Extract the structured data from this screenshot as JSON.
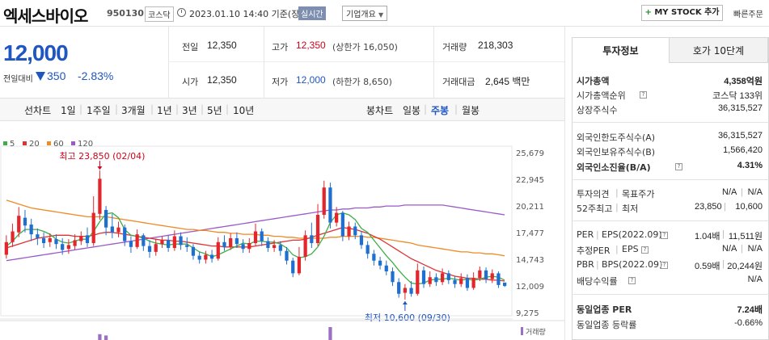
{
  "header": {
    "stock_name": "엑세스바이오",
    "stock_code": "950130",
    "market": "코스닥",
    "datetime": "2023.01.10 14:40 기준(장중)",
    "realtime": "실시간",
    "company_overview": "기업개요",
    "mystock_label": "MY STOCK 추가",
    "quick_order": "빠른주문"
  },
  "price": {
    "current": "12,000",
    "change_label": "전일대비",
    "change": "350",
    "change_pct": "-2.83%",
    "direction": "down"
  },
  "stats": {
    "prev_close_label": "전일",
    "prev_close": "12,350",
    "high_label": "고가",
    "high": "12,350",
    "upper_limit": "(상한가 16,050)",
    "volume_label": "거래량",
    "volume": "218,303",
    "open_label": "시가",
    "open": "12,350",
    "low_label": "저가",
    "low": "12,000",
    "lower_limit": "(하한가 8,650)",
    "amount_label": "거래대금",
    "amount": "2,645 백만"
  },
  "tabs": {
    "line_chart": "선차트",
    "line_periods": [
      "1일",
      "1주일",
      "3개월",
      "1년",
      "3년",
      "5년",
      "10년"
    ],
    "candle_chart": "봉차트",
    "candle_periods": [
      "일봉",
      "주봉",
      "월봉"
    ],
    "active_candle": "주봉"
  },
  "chart_data": {
    "type": "candlestick",
    "moving_average_legend": [
      {
        "name": "5",
        "color": "#3fae49"
      },
      {
        "name": "20",
        "color": "#e03232"
      },
      {
        "name": "60",
        "color": "#f08a24"
      },
      {
        "name": "120",
        "color": "#9b59c9"
      }
    ],
    "y_ticks": [
      "25,679",
      "22,945",
      "20,211",
      "17,477",
      "14,743",
      "12,009",
      "9,275"
    ],
    "y_tick_values": [
      25679,
      22945,
      20211,
      17477,
      14743,
      12009,
      9275
    ],
    "high_annotation": "최고 23,850 (02/04)",
    "low_annotation": "최저 10,600 (09/30)",
    "volume_label": "거래량",
    "candles": [
      {
        "o": 15200,
        "c": 16500,
        "h": 17200,
        "l": 14800
      },
      {
        "o": 16500,
        "c": 17600,
        "h": 18400,
        "l": 16000
      },
      {
        "o": 17500,
        "c": 19200,
        "h": 20100,
        "l": 17000
      },
      {
        "o": 19000,
        "c": 18200,
        "h": 19800,
        "l": 17500
      },
      {
        "o": 18300,
        "c": 17300,
        "h": 18900,
        "l": 16600
      },
      {
        "o": 17300,
        "c": 16900,
        "h": 17900,
        "l": 16200
      },
      {
        "o": 16900,
        "c": 16400,
        "h": 17500,
        "l": 15900
      },
      {
        "o": 16500,
        "c": 16900,
        "h": 17400,
        "l": 16000
      },
      {
        "o": 16800,
        "c": 16300,
        "h": 17300,
        "l": 15800
      },
      {
        "o": 16300,
        "c": 15700,
        "h": 16900,
        "l": 15200
      },
      {
        "o": 15800,
        "c": 16200,
        "h": 16800,
        "l": 15300
      },
      {
        "o": 16100,
        "c": 16700,
        "h": 17300,
        "l": 15700
      },
      {
        "o": 16600,
        "c": 17100,
        "h": 17600,
        "l": 16200
      },
      {
        "o": 17200,
        "c": 16400,
        "h": 18000,
        "l": 16000
      },
      {
        "o": 16400,
        "c": 19500,
        "h": 21200,
        "l": 16100
      },
      {
        "o": 19400,
        "c": 23000,
        "h": 23850,
        "l": 18800
      },
      {
        "o": 19800,
        "c": 18000,
        "h": 20200,
        "l": 17200
      },
      {
        "o": 18100,
        "c": 17500,
        "h": 19400,
        "l": 16900
      },
      {
        "o": 17500,
        "c": 18000,
        "h": 18600,
        "l": 17000
      },
      {
        "o": 18000,
        "c": 16600,
        "h": 18300,
        "l": 16100
      },
      {
        "o": 16600,
        "c": 16000,
        "h": 17100,
        "l": 15400
      },
      {
        "o": 16000,
        "c": 17300,
        "h": 17800,
        "l": 15800
      },
      {
        "o": 17200,
        "c": 16100,
        "h": 17400,
        "l": 15600
      },
      {
        "o": 16100,
        "c": 15500,
        "h": 16700,
        "l": 14900
      },
      {
        "o": 15500,
        "c": 16300,
        "h": 16800,
        "l": 15100
      },
      {
        "o": 16300,
        "c": 16700,
        "h": 17100,
        "l": 15900
      },
      {
        "o": 16700,
        "c": 15900,
        "h": 17200,
        "l": 15500
      },
      {
        "o": 15900,
        "c": 17100,
        "h": 17700,
        "l": 15600
      },
      {
        "o": 17100,
        "c": 16200,
        "h": 17500,
        "l": 15700
      },
      {
        "o": 16200,
        "c": 16000,
        "h": 17000,
        "l": 15500
      },
      {
        "o": 16000,
        "c": 15100,
        "h": 16300,
        "l": 14700
      },
      {
        "o": 15100,
        "c": 14700,
        "h": 15500,
        "l": 14300
      },
      {
        "o": 14700,
        "c": 15200,
        "h": 15600,
        "l": 14300
      },
      {
        "o": 15200,
        "c": 14800,
        "h": 15700,
        "l": 14400
      },
      {
        "o": 14800,
        "c": 16500,
        "h": 17000,
        "l": 14600
      },
      {
        "o": 16500,
        "c": 16000,
        "h": 17200,
        "l": 15600
      },
      {
        "o": 16000,
        "c": 16900,
        "h": 17400,
        "l": 15700
      },
      {
        "o": 16900,
        "c": 16300,
        "h": 17500,
        "l": 15900
      },
      {
        "o": 16300,
        "c": 15800,
        "h": 16800,
        "l": 15400
      },
      {
        "o": 15800,
        "c": 16400,
        "h": 16900,
        "l": 15400
      },
      {
        "o": 16400,
        "c": 17600,
        "h": 18400,
        "l": 16100
      },
      {
        "o": 17600,
        "c": 16600,
        "h": 17900,
        "l": 16100
      },
      {
        "o": 16600,
        "c": 15900,
        "h": 17000,
        "l": 15500
      },
      {
        "o": 15900,
        "c": 16200,
        "h": 16700,
        "l": 15500
      },
      {
        "o": 16200,
        "c": 15600,
        "h": 16600,
        "l": 15100
      },
      {
        "o": 15600,
        "c": 14600,
        "h": 16000,
        "l": 14200
      },
      {
        "o": 14600,
        "c": 13300,
        "h": 14900,
        "l": 12900
      },
      {
        "o": 13300,
        "c": 15000,
        "h": 16000,
        "l": 13100
      },
      {
        "o": 15000,
        "c": 17200,
        "h": 17700,
        "l": 14600
      },
      {
        "o": 17200,
        "c": 16400,
        "h": 18500,
        "l": 15900
      },
      {
        "o": 16400,
        "c": 19300,
        "h": 20400,
        "l": 16100
      },
      {
        "o": 19300,
        "c": 22100,
        "h": 22800,
        "l": 18900
      },
      {
        "o": 22100,
        "c": 18500,
        "h": 22600,
        "l": 17900
      },
      {
        "o": 18500,
        "c": 19500,
        "h": 20100,
        "l": 18100
      },
      {
        "o": 19500,
        "c": 17100,
        "h": 19700,
        "l": 16600
      },
      {
        "o": 17100,
        "c": 18100,
        "h": 18600,
        "l": 16700
      },
      {
        "o": 18100,
        "c": 17200,
        "h": 18500,
        "l": 16800
      },
      {
        "o": 17200,
        "c": 16200,
        "h": 17600,
        "l": 15800
      },
      {
        "o": 16200,
        "c": 15300,
        "h": 16600,
        "l": 14800
      },
      {
        "o": 15300,
        "c": 14600,
        "h": 15700,
        "l": 14100
      },
      {
        "o": 14600,
        "c": 14100,
        "h": 15000,
        "l": 13700
      },
      {
        "o": 14100,
        "c": 13500,
        "h": 14600,
        "l": 13100
      },
      {
        "o": 13500,
        "c": 12400,
        "h": 13900,
        "l": 12000
      },
      {
        "o": 12400,
        "c": 11200,
        "h": 12800,
        "l": 10800
      },
      {
        "o": 11300,
        "c": 11800,
        "h": 12200,
        "l": 10600
      },
      {
        "o": 11800,
        "c": 11200,
        "h": 12500,
        "l": 10900
      },
      {
        "o": 11200,
        "c": 13600,
        "h": 14300,
        "l": 11000
      },
      {
        "o": 13600,
        "c": 12200,
        "h": 14000,
        "l": 11800
      },
      {
        "o": 12200,
        "c": 12900,
        "h": 13500,
        "l": 11900
      },
      {
        "o": 12900,
        "c": 12400,
        "h": 13300,
        "l": 12000
      },
      {
        "o": 12400,
        "c": 13300,
        "h": 13800,
        "l": 12100
      },
      {
        "o": 13300,
        "c": 12600,
        "h": 13600,
        "l": 12200
      },
      {
        "o": 12600,
        "c": 12200,
        "h": 13000,
        "l": 11800
      },
      {
        "o": 12200,
        "c": 12800,
        "h": 13300,
        "l": 11900
      },
      {
        "o": 12800,
        "c": 11800,
        "h": 13200,
        "l": 11500
      },
      {
        "o": 11800,
        "c": 12800,
        "h": 13400,
        "l": 11600
      },
      {
        "o": 12800,
        "c": 13600,
        "h": 14000,
        "l": 12500
      },
      {
        "o": 13600,
        "c": 12700,
        "h": 13900,
        "l": 12300
      },
      {
        "o": 12700,
        "c": 13300,
        "h": 13700,
        "l": 12300
      },
      {
        "o": 13300,
        "c": 12100,
        "h": 13500,
        "l": 11800
      },
      {
        "o": 12350,
        "c": 12000,
        "h": 12350,
        "l": 11900
      }
    ],
    "ma5": [
      16100,
      16600,
      17300,
      17800,
      17800,
      17800,
      17600,
      17300,
      16800,
      16500,
      16400,
      16600,
      16800,
      16800,
      17600,
      18600,
      19400,
      19500,
      19000,
      17800,
      17200,
      17100,
      16900,
      16600,
      16400,
      16300,
      16200,
      16300,
      16300,
      16300,
      15900,
      15500,
      15300,
      15000,
      15200,
      15500,
      15800,
      16100,
      16400,
      16300,
      16600,
      16600,
      16500,
      16500,
      16300,
      15900,
      15200,
      14900,
      15000,
      15300,
      16000,
      17100,
      18500,
      19300,
      19500,
      19300,
      18800,
      17900,
      17500,
      16700,
      15900,
      15100,
      14400,
      13600,
      12900,
      12300,
      12200,
      12300,
      12600,
      12700,
      12700,
      12800,
      12700,
      12600,
      12700,
      12600,
      12700,
      12900,
      13000,
      12900,
      12600
    ],
    "ma20": [
      15900,
      16100,
      16300,
      16500,
      16700,
      16900,
      17000,
      17100,
      17200,
      17200,
      17200,
      17100,
      17100,
      17100,
      17200,
      17400,
      17500,
      17500,
      17400,
      17300,
      17200,
      17100,
      17000,
      16900,
      16800,
      16700,
      16700,
      16600,
      16600,
      16500,
      16400,
      16300,
      16200,
      16100,
      16100,
      16000,
      16000,
      16000,
      16000,
      16000,
      16100,
      16200,
      16300,
      16400,
      16500,
      16600,
      16700,
      16700,
      16800,
      17000,
      17200,
      17400,
      17600,
      17800,
      18000,
      17900,
      17800,
      17600,
      17400,
      17100,
      16800,
      16400,
      16000,
      15600,
      15200,
      14800,
      14500,
      14200,
      13900,
      13600,
      13400,
      13200,
      13000,
      12900,
      12800,
      12800,
      12700,
      12700,
      12600,
      12600,
      12500
    ],
    "ma60": [
      20800,
      20600,
      20400,
      20200,
      20000,
      19900,
      19800,
      19700,
      19600,
      19500,
      19400,
      19300,
      19200,
      19100,
      19100,
      19100,
      19100,
      19000,
      18900,
      18800,
      18700,
      18600,
      18500,
      18400,
      18300,
      18200,
      18100,
      18000,
      17900,
      17800,
      17800,
      17700,
      17700,
      17600,
      17500,
      17500,
      17400,
      17400,
      17300,
      17300,
      17300,
      17200,
      17200,
      17100,
      17100,
      17000,
      17000,
      16900,
      16900,
      16900,
      16900,
      16900,
      17000,
      17000,
      17100,
      17100,
      17100,
      17100,
      17000,
      17000,
      16900,
      16800,
      16700,
      16600,
      16500,
      16400,
      16200,
      16100,
      16000,
      15900,
      15800,
      15700,
      15600,
      15500,
      15500,
      15400,
      15400,
      15300,
      15300,
      15200,
      15100
    ],
    "ma120": [
      14600,
      14700,
      14800,
      14900,
      15000,
      15100,
      15200,
      15300,
      15400,
      15500,
      15600,
      15700,
      15800,
      15900,
      16000,
      16100,
      16200,
      16300,
      16400,
      16500,
      16600,
      16700,
      16800,
      16900,
      17000,
      17100,
      17200,
      17300,
      17400,
      17500,
      17600,
      17700,
      17800,
      17900,
      18000,
      18100,
      18200,
      18300,
      18400,
      18500,
      18600,
      18700,
      18800,
      18900,
      19000,
      19100,
      19200,
      19300,
      19400,
      19500,
      19600,
      19700,
      19800,
      19800,
      19900,
      19900,
      20000,
      20000,
      20000,
      20100,
      20100,
      20200,
      20200,
      20200,
      20300,
      20300,
      20300,
      20300,
      20300,
      20300,
      20300,
      20200,
      20100,
      20000,
      19900,
      19800,
      19700,
      19600,
      19500,
      19400,
      19300
    ],
    "volume_spikes": [
      {
        "index": 15,
        "rel": 0.45
      },
      {
        "index": 16,
        "rel": 0.35
      },
      {
        "index": 52,
        "rel": 1.0
      }
    ]
  },
  "right_panel": {
    "tabs": [
      "투자정보",
      "호가 10단계"
    ],
    "active_tab": "투자정보",
    "market_cap_label": "시가총액",
    "market_cap": "4,358억원",
    "market_cap_rank_label": "시가총액순위",
    "market_cap_rank": "코스닥 133위",
    "shares_label": "상장주식수",
    "shares": "36,315,527",
    "foreign_limit_label": "외국인한도주식수(A)",
    "foreign_limit": "36,315,527",
    "foreign_hold_label": "외국인보유주식수(B)",
    "foreign_hold": "1,566,420",
    "foreign_ratio_label": "외국인소진율(B/A)",
    "foreign_ratio": "4.31%",
    "opinion_label": "투자의견",
    "target_label": "목표주가",
    "opinion": "N/A",
    "target": "N/A",
    "week52_label": "52주최고",
    "week52_low_label": "최저",
    "week52_high": "23,850",
    "week52_low": "10,600",
    "per_label": "PER",
    "eps_label": "EPS(2022.09)",
    "per": "1.04배",
    "eps": "11,511원",
    "est_per_label": "추정PER",
    "est_eps_label": "EPS",
    "est_per": "N/A",
    "est_eps": "N/A",
    "pbr_label": "PBR",
    "bps_label": "BPS(2022.09)",
    "pbr": "0.59배",
    "bps": "20,244원",
    "div_label": "배당수익률",
    "div": "N/A",
    "sector_per_label": "동일업종 PER",
    "sector_per": "7.24배",
    "sector_change_label": "동일업종 등락률",
    "sector_change": "-0.66%"
  }
}
